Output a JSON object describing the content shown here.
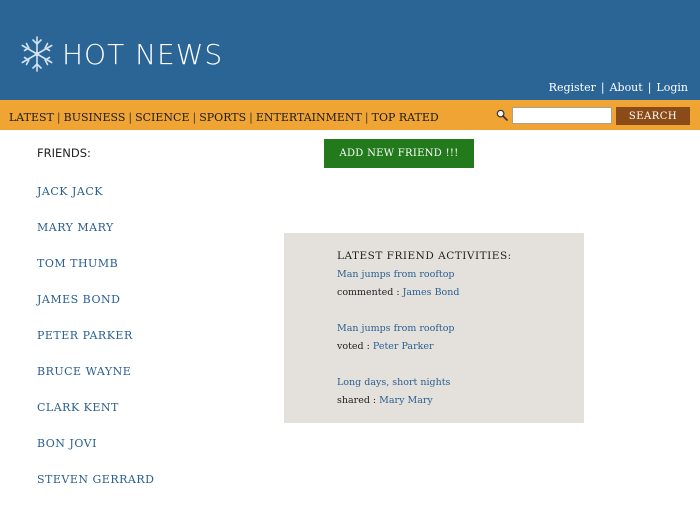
{
  "header": {
    "logo_text": "HOT NEWS",
    "logo_icon": "snowflake-icon",
    "links": [
      "Register",
      "About",
      "Login"
    ]
  },
  "nav": {
    "items": [
      "LATEST",
      "BUSINESS",
      "SCIENCE",
      "SPORTS",
      "ENTERTAINMENT",
      "TOP RATED"
    ]
  },
  "search": {
    "icon": "magnifier-icon",
    "value": "",
    "button_label": "SEARCH"
  },
  "friends": {
    "heading": "FRIENDS:",
    "items": [
      "JACK JACK",
      "MARY MARY",
      "TOM THUMB",
      "JAMES BOND",
      "PETER PARKER",
      "BRUCE WAYNE",
      "CLARK KENT",
      "BON JOVI",
      "STEVEN GERRARD"
    ]
  },
  "add_friend_button": "ADD NEW  FRIEND !!!",
  "activities": {
    "title": "LATEST FRIEND ACTIVITIES:",
    "items": [
      {
        "story": "Man jumps from rooftop",
        "action": "commented :",
        "friend": "James Bond"
      },
      {
        "story": "Man jumps from rooftop",
        "action": "voted :",
        "friend": "Peter Parker"
      },
      {
        "story": "Long days, short nights",
        "action": "shared :",
        "friend": "Mary Mary"
      }
    ]
  },
  "colors": {
    "header_bg": "#2a6596",
    "navbar_bg": "#f0a434",
    "search_button": "#8a4b18",
    "add_button": "#237a1c",
    "activity_bg": "#e4e1dd",
    "link": "#2a5f8f"
  }
}
